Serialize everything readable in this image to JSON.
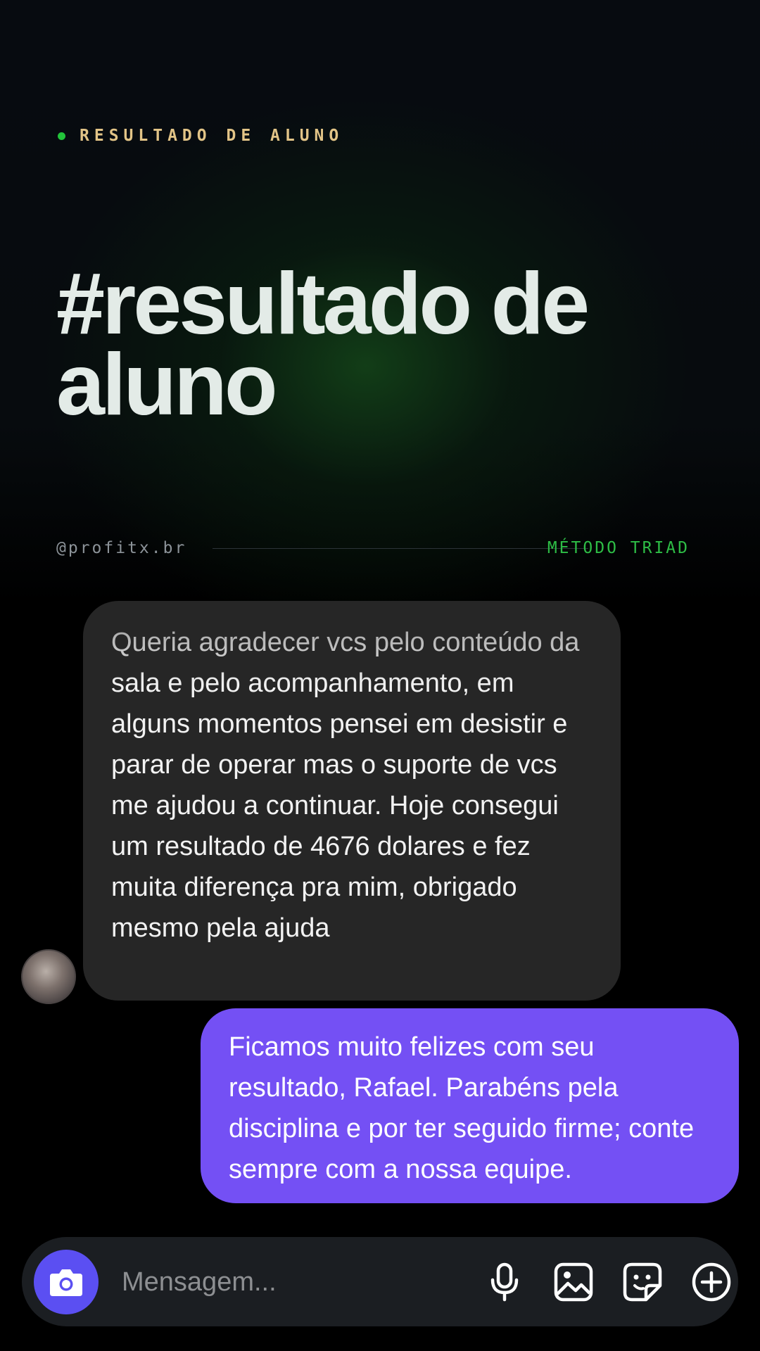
{
  "header": {
    "eyebrow": "RESULTADO DE ALUNO",
    "headline_line1": "#resultado de",
    "headline_line2": "aluno",
    "handle": "@profitx.br",
    "method": "MÉTODO TRIAD",
    "accent_color": "#22c33a"
  },
  "chat": {
    "incoming": {
      "text": "Queria agradecer vcs pelo conteúdo da sala e pelo acompanhamento, em alguns momentos pensei em desistir e parar de operar mas o suporte de vcs me ajudou a continuar. Hoje consegui um resultado de 4676 dolares e fez muita diferença pra mim, obrigado mesmo pela ajuda",
      "bubble_color": "#262626"
    },
    "outgoing": {
      "text": "Ficamos muito felizes com seu resultado, Rafael. Parabéns pela disciplina e por ter seguido firme; conte sempre com a nossa equipe.",
      "bubble_color": "#7450f4"
    }
  },
  "composer": {
    "placeholder": "Mensagem...",
    "icons": [
      "camera-icon",
      "microphone-icon",
      "gallery-icon",
      "sticker-icon",
      "plus-icon"
    ],
    "camera_color": "#5b4ff2"
  }
}
